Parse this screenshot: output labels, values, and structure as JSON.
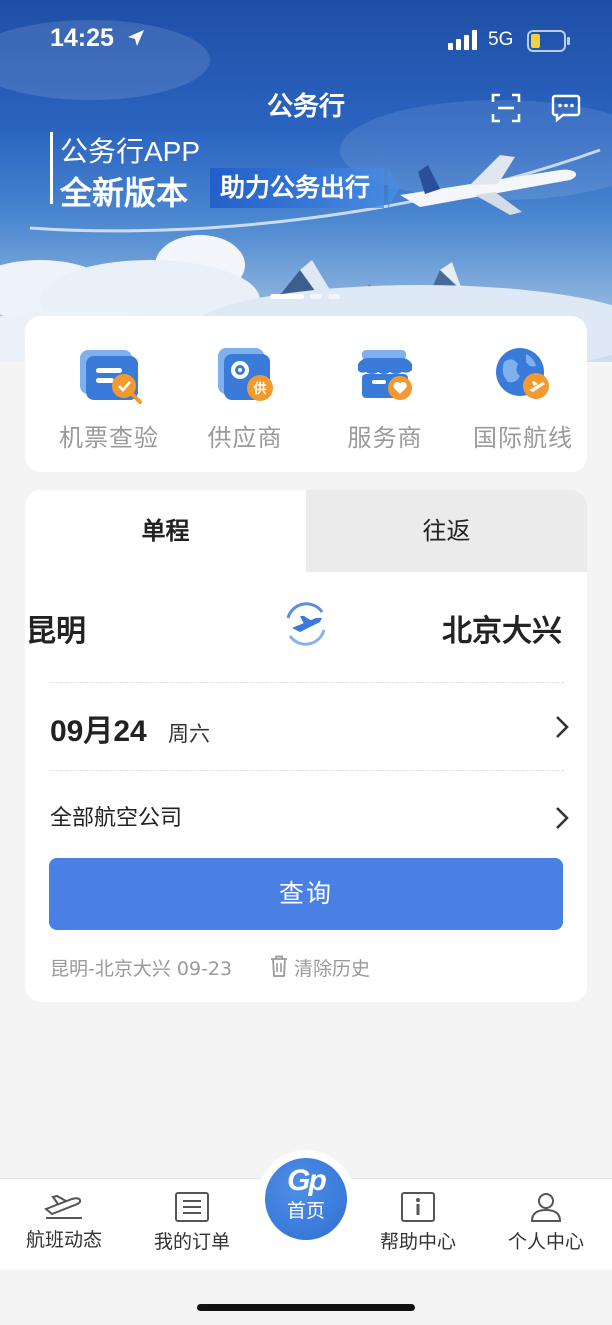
{
  "status_bar": {
    "time": "14:25",
    "network": "5G",
    "icons": [
      "location-arrow-icon",
      "signal-bars-icon",
      "battery-icon"
    ]
  },
  "header": {
    "title": "公务行",
    "right_icons": [
      "scan-icon",
      "message-icon"
    ]
  },
  "banner": {
    "line1": "公务行APP",
    "line2": "全新版本",
    "tag": "助力公务出行",
    "page_count": 3,
    "active_page": 1
  },
  "quick_menu": [
    {
      "label": "机票查验",
      "icon": "ticket-check-icon"
    },
    {
      "label": "供应商",
      "icon": "supplier-icon"
    },
    {
      "label": "服务商",
      "icon": "service-provider-icon"
    },
    {
      "label": "国际航线",
      "icon": "international-route-icon"
    }
  ],
  "search": {
    "tabs": [
      {
        "label": "单程",
        "active": true
      },
      {
        "label": "往返",
        "active": false
      }
    ],
    "from_city": "昆明",
    "to_city": "北京大兴",
    "date": "09月24",
    "weekday": "周六",
    "airline": "全部航空公司",
    "query_button": "查询",
    "history_item": "昆明-北京大兴 09-23",
    "clear_history": "清除历史"
  },
  "bottom_nav": {
    "items": [
      {
        "label": "航班动态",
        "icon": "flight-status-icon"
      },
      {
        "label": "我的订单",
        "icon": "orders-icon"
      },
      {
        "label": "首页",
        "icon": "home-logo-icon",
        "logo": "Gp"
      },
      {
        "label": "帮助中心",
        "icon": "help-center-icon"
      },
      {
        "label": "个人中心",
        "icon": "profile-icon"
      }
    ],
    "active": "首页"
  },
  "colors": {
    "accent": "#4a7fe4",
    "icon_blue": "#3a7ad8",
    "icon_orange": "#f39a2e",
    "page_bg": "#f4f4f4"
  }
}
